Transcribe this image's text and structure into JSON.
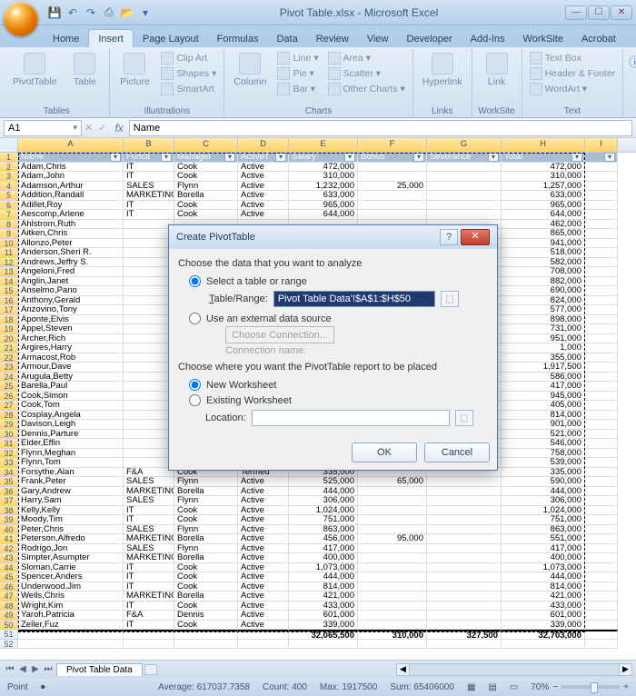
{
  "app": {
    "title": "Pivot Table.xlsx - Microsoft Excel"
  },
  "qat_icons": [
    "save-icon",
    "undo-icon",
    "redo-icon",
    "print-icon",
    "open-icon"
  ],
  "tabs": [
    "Home",
    "Insert",
    "Page Layout",
    "Formulas",
    "Data",
    "Review",
    "View",
    "Developer",
    "Add-Ins",
    "WorkSite",
    "Acrobat"
  ],
  "active_tab": 1,
  "ribbon": {
    "groups": [
      {
        "label": "Tables",
        "big": [
          "PivotTable",
          "Table"
        ]
      },
      {
        "label": "Illustrations",
        "big": [
          "Picture"
        ],
        "small": [
          "Clip Art",
          "Shapes ▾",
          "SmartArt"
        ]
      },
      {
        "label": "Charts",
        "big": [
          "Column"
        ],
        "small": [
          "Line ▾",
          "Pie ▾",
          "Bar ▾",
          "Area ▾",
          "Scatter ▾",
          "Other Charts ▾"
        ]
      },
      {
        "label": "Links",
        "big": [
          "Hyperlink"
        ]
      },
      {
        "label": "WorkSite",
        "big": [
          "Link"
        ]
      },
      {
        "label": "Text",
        "small": [
          "Text Box",
          "Header & Footer",
          "WordArt ▾"
        ]
      }
    ]
  },
  "namebox": "A1",
  "formula": "Name",
  "columns": [
    "A",
    "B",
    "C",
    "D",
    "E",
    "F",
    "G",
    "H",
    "I"
  ],
  "headers": [
    "Name",
    "Functi",
    "Manager",
    "ActiveT",
    "Salary",
    "Bonus",
    "Severance",
    "Total"
  ],
  "rows": [
    [
      "Adam,Chris",
      "IT",
      "Cook",
      "Active",
      "472,000",
      "",
      "",
      "472,000"
    ],
    [
      "Adam,John",
      "IT",
      "Cook",
      "Active",
      "310,000",
      "",
      "",
      "310,000"
    ],
    [
      "Adamson,Arthur",
      "SALES",
      "Flynn",
      "Active",
      "1,232,000",
      "25,000",
      "",
      "1,257,000"
    ],
    [
      "Addition,Randall",
      "MARKETING",
      "Borella",
      "Active",
      "633,000",
      "",
      "",
      "633,000"
    ],
    [
      "Adillet,Roy",
      "IT",
      "Cook",
      "Active",
      "965,000",
      "",
      "",
      "965,000"
    ],
    [
      "Aescomp,Arlene",
      "IT",
      "Cook",
      "Active",
      "644,000",
      "",
      "",
      "644,000"
    ],
    [
      "Ahlstrom,Ruth",
      "",
      "",
      "",
      "",
      "",
      "",
      "462,000"
    ],
    [
      "Aitken,Chris",
      "",
      "",
      "",
      "",
      "",
      "",
      "865,000"
    ],
    [
      "Allonzo,Peter",
      "",
      "",
      "",
      "",
      "",
      "",
      "941,000"
    ],
    [
      "Anderson,Sheri R.",
      "",
      "",
      "",
      "",
      "",
      "",
      "518,000"
    ],
    [
      "Andrews,Jeffry S.",
      "",
      "",
      "",
      "",
      "",
      "",
      "582,000"
    ],
    [
      "Angeloni,Fred",
      "",
      "",
      "",
      "",
      "",
      "",
      "708,000"
    ],
    [
      "Anglin,Janet",
      "",
      "",
      "",
      "",
      "",
      "",
      "882,000"
    ],
    [
      "Anselmo,Pano",
      "",
      "",
      "",
      "",
      "",
      "",
      "690,000"
    ],
    [
      "Anthony,Gerald",
      "",
      "",
      "",
      "",
      "",
      "",
      "824,000"
    ],
    [
      "Anzovino,Tony",
      "",
      "",
      "",
      "",
      "",
      "",
      "577,000"
    ],
    [
      "Aponte,Elvis",
      "",
      "",
      "",
      "",
      "",
      "",
      "898,000"
    ],
    [
      "Appel,Steven",
      "",
      "",
      "",
      "",
      "",
      "",
      "731,000"
    ],
    [
      "Archer,Rich",
      "",
      "",
      "",
      "",
      "",
      "",
      "951,000"
    ],
    [
      "Argires,Harry",
      "",
      "",
      "",
      "",
      "",
      "",
      "1,000"
    ],
    [
      "Armacost,Rob",
      "",
      "",
      "",
      "",
      "",
      "",
      "355,000"
    ],
    [
      "Armour,Dave",
      "",
      "",
      "",
      "",
      "",
      "",
      "1,917,500"
    ],
    [
      "Arugula,Betty",
      "",
      "",
      "",
      "",
      "",
      "",
      "586,000"
    ],
    [
      "Barella,Paul",
      "",
      "",
      "",
      "",
      "",
      "",
      "417,000"
    ],
    [
      "Cook,Simon",
      "",
      "",
      "",
      "",
      "",
      "",
      "945,000"
    ],
    [
      "Cook,Tom",
      "",
      "",
      "",
      "",
      "",
      "",
      "405,000"
    ],
    [
      "Cosplay,Angela",
      "",
      "",
      "",
      "",
      "",
      "",
      "814,000"
    ],
    [
      "Davison,Leigh",
      "",
      "",
      "",
      "",
      "",
      "",
      "901,000"
    ],
    [
      "Dennis,Parture",
      "",
      "",
      "",
      "",
      "",
      "",
      "521,000"
    ],
    [
      "Elder,Effin",
      "",
      "",
      "",
      "",
      "",
      "",
      "546,000"
    ],
    [
      "Flynn,Meghan",
      "",
      "",
      "",
      "",
      "",
      "",
      "758,000"
    ],
    [
      "Flynn,Tom",
      "",
      "",
      "",
      "",
      "",
      "",
      "539,000"
    ],
    [
      "Forsythe,Alan",
      "F&A",
      "Cook",
      "Termed",
      "335,000",
      "",
      "",
      "335,000"
    ],
    [
      "Frank,Peter",
      "SALES",
      "Flynn",
      "Active",
      "525,000",
      "65,000",
      "",
      "590,000"
    ],
    [
      "Gary,Andrew",
      "MARKETING",
      "Borella",
      "Active",
      "444,000",
      "",
      "",
      "444,000"
    ],
    [
      "Harry,Sam",
      "SALES",
      "Flynn",
      "Active",
      "306,000",
      "",
      "",
      "306,000"
    ],
    [
      "Kelly,Kelly",
      "IT",
      "Cook",
      "Active",
      "1,024,000",
      "",
      "",
      "1,024,000"
    ],
    [
      "Moody,Tim",
      "IT",
      "Cook",
      "Active",
      "751,000",
      "",
      "",
      "751,000"
    ],
    [
      "Peter,Chris",
      "SALES",
      "Flynn",
      "Active",
      "863,000",
      "",
      "",
      "863,000"
    ],
    [
      "Peterson,Alfredo",
      "MARKETING",
      "Borella",
      "Active",
      "456,000",
      "95,000",
      "",
      "551,000"
    ],
    [
      "Rodrigo,Jon",
      "SALES",
      "Flynn",
      "Active",
      "417,000",
      "",
      "",
      "417,000"
    ],
    [
      "Simpter,Asumpter",
      "MARKETING",
      "Borella",
      "Active",
      "400,000",
      "",
      "",
      "400,000"
    ],
    [
      "Sloman,Carrie",
      "IT",
      "Cook",
      "Active",
      "1,073,000",
      "",
      "",
      "1,073,000"
    ],
    [
      "Spencer,Anders",
      "IT",
      "Cook",
      "Active",
      "444,000",
      "",
      "",
      "444,000"
    ],
    [
      "Underwood,Jim",
      "IT",
      "Cook",
      "Active",
      "814,000",
      "",
      "",
      "814,000"
    ],
    [
      "Wells,Chris",
      "MARKETING",
      "Borella",
      "Active",
      "421,000",
      "",
      "",
      "421,000"
    ],
    [
      "Wright,Kim",
      "IT",
      "Cook",
      "Active",
      "433,000",
      "",
      "",
      "433,000"
    ],
    [
      "Yaroh,Patricia",
      "F&A",
      "Dennis",
      "Active",
      "601,000",
      "",
      "",
      "601,000"
    ],
    [
      "Zeller,Fuz",
      "IT",
      "Cook",
      "Active",
      "339,000",
      "",
      "",
      "339,000"
    ]
  ],
  "totals": [
    "",
    "",
    "",
    "",
    "32,065,500",
    "310,000",
    "327,500",
    "32,703,000"
  ],
  "sheettab": "Pivot Table Data",
  "status": {
    "mode": "Point",
    "avg": "Average: 617037.7358",
    "count": "Count: 400",
    "max": "Max: 1917500",
    "sum": "Sum: 65406000",
    "zoom": "70%"
  },
  "dialog": {
    "title": "Create PivotTable",
    "hdr1": "Choose the data that you want to analyze",
    "opt1": "Select a table or range",
    "rangeLabel": "Table/Range:",
    "range": "Pivot Table Data'!$A$1:$H$50",
    "opt2": "Use an external data source",
    "choose": "Choose Connection...",
    "connLabel": "Connection name:",
    "hdr2": "Choose where you want the PivotTable report to be placed",
    "opt3": "New Worksheet",
    "opt4": "Existing Worksheet",
    "locLabel": "Location:",
    "ok": "OK",
    "cancel": "Cancel"
  }
}
